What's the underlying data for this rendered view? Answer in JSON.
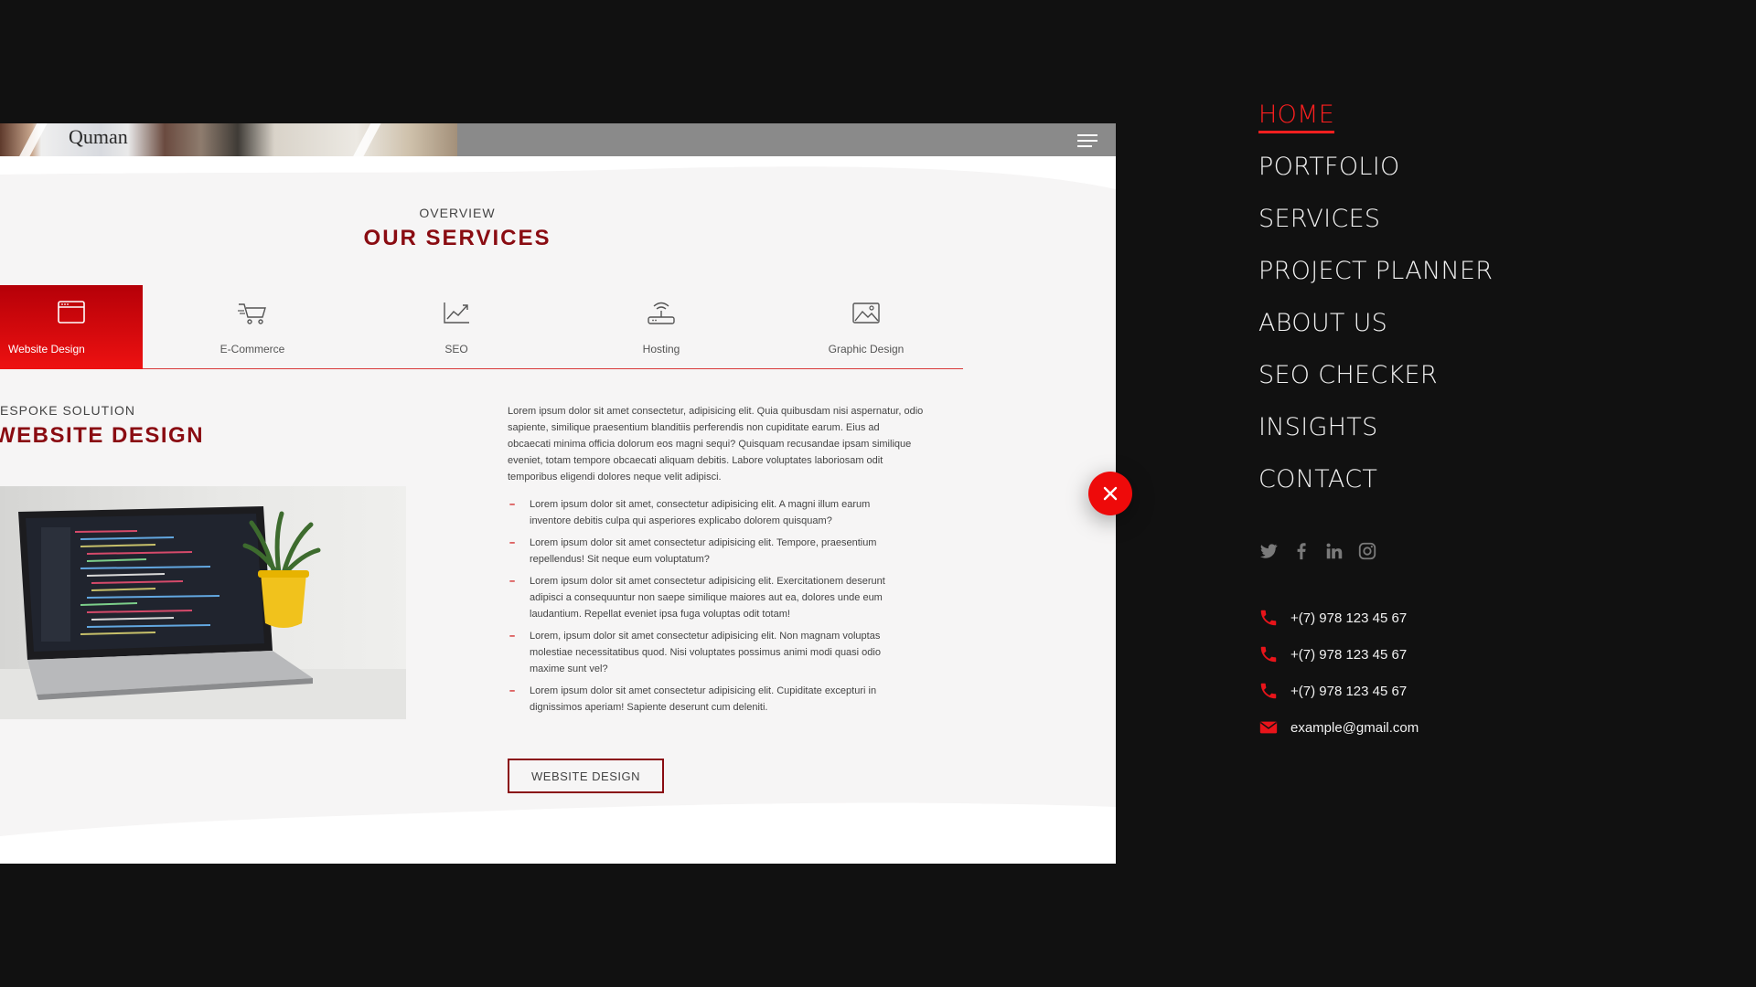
{
  "page": {
    "logo": "Quman",
    "overview_label": "OVERVIEW",
    "section_heading": "OUR SERVICES",
    "tabs": [
      {
        "label": "Website Design",
        "icon": "browser-window-icon",
        "active": true
      },
      {
        "label": "E-Commerce",
        "icon": "shopping-cart-icon",
        "active": false
      },
      {
        "label": "SEO",
        "icon": "trend-chart-icon",
        "active": false
      },
      {
        "label": "Hosting",
        "icon": "wifi-router-icon",
        "active": false
      },
      {
        "label": "Graphic Design",
        "icon": "image-icon",
        "active": false
      }
    ],
    "subtitle": "ESPOKE SOLUTION",
    "title": "WEBSITE DESIGN",
    "intro": "Lorem ipsum dolor sit amet consectetur, adipisicing elit. Quia quibusdam nisi aspernatur, odio sapiente, similique praesentium blanditiis perferendis non cupiditate earum. Eius ad obcaecati minima officia dolorum eos magni sequi? Quisquam recusandae ipsam similique eveniet, totam tempore obcaecati aliquam debitis. Labore voluptates laboriosam odit temporibus eligendi dolores neque velit adipisci.",
    "bullets": [
      "Lorem ipsum dolor sit amet, consectetur adipisicing elit. A magni illum earum inventore debitis culpa qui asperiores explicabo dolorem quisquam?",
      "Lorem ipsum dolor sit amet consectetur adipisicing elit. Tempore, praesentium repellendus! Sit neque eum voluptatum?",
      "Lorem ipsum dolor sit amet consectetur adipisicing elit. Exercitationem deserunt adipisci a consequuntur non saepe similique maiores aut ea, dolores unde eum laudantium. Repellat eveniet ipsa fuga voluptas odit totam!",
      "Lorem, ipsum dolor sit amet consectetur adipisicing elit. Non magnam voluptas molestiae necessitatibus quod. Nisi voluptates possimus animi modi quasi odio maxime sunt vel?",
      "Lorem ipsum dolor sit amet consectetur adipisicing elit. Cupiditate excepturi in dignissimos aperiam! Sapiente deserunt cum deleniti."
    ],
    "button_label": "WEBSITE DESIGN"
  },
  "menu": {
    "items": [
      "HOME",
      "PORTFOLIO",
      "SERVICES",
      "PROJECT PLANNER",
      "ABOUT US",
      "SEO CHECKER",
      "INSIGHTS",
      "CONTACT"
    ],
    "active_index": 0,
    "social": [
      "twitter-icon",
      "facebook-icon",
      "linkedin-icon",
      "instagram-icon"
    ],
    "contacts": [
      {
        "icon": "phone-icon",
        "text": "+(7) 978 123 45 67"
      },
      {
        "icon": "phone-icon",
        "text": "+(7) 978 123 45 67"
      },
      {
        "icon": "phone-icon",
        "text": "+(7) 978 123 45 67"
      },
      {
        "icon": "envelope-icon",
        "text": "example@gmail.com"
      }
    ]
  },
  "colors": {
    "accent": "#ee0a0a",
    "heading": "#8a0c12",
    "background": "#111111",
    "page": "#f6f5f5"
  }
}
